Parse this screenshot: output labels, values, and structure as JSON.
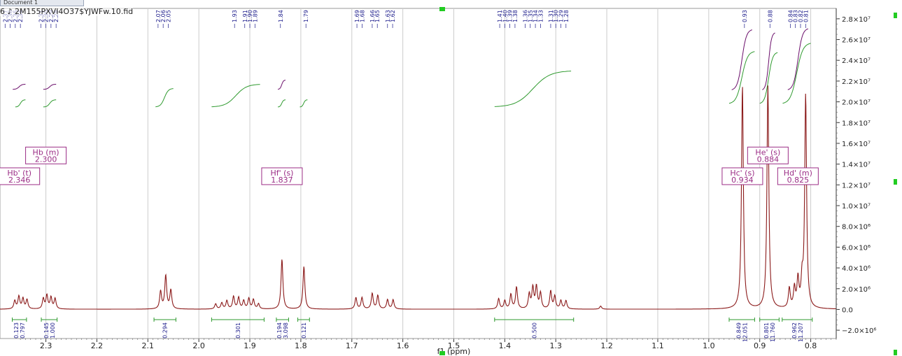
{
  "window": {
    "tab_label": "Document 1",
    "file_title": "6 ♪ 2M155PXVI4O37$YJWFw.10.fid"
  },
  "colors": {
    "spectrum": "#8b1a1a",
    "integral_purple": "#6b0f6b",
    "integral_green": "#2f9a2f",
    "peak_label": "#1a1a8a",
    "box_border": "#9b2d86",
    "range_bar": "#2e9a2e",
    "grid": "#cccccc",
    "green_marker": "#22cc22"
  },
  "chart_data": {
    "type": "line",
    "xlabel": "f1 (ppm)",
    "ylabel": "",
    "title": "",
    "x_reversed": true,
    "xlim": [
      2.39,
      0.75
    ],
    "ylim": [
      -2800000,
      29000000
    ],
    "x_ticks": [
      2.3,
      2.2,
      2.1,
      2.0,
      1.9,
      1.8,
      1.7,
      1.6,
      1.5,
      1.4,
      1.3,
      1.2,
      1.1,
      1.0,
      0.9,
      0.8
    ],
    "x_tick_labels": [
      "2.3",
      "2.2",
      "2.1",
      "2.0",
      "1.9",
      "1.8",
      "1.7",
      "1.6",
      "1.5",
      "1.4",
      "1.3",
      "1.2",
      "1.1",
      "1.0",
      "0.9",
      "0.8"
    ],
    "y_ticks": [
      -2000000,
      0,
      2000000,
      4000000,
      6000000,
      8000000,
      10000000,
      12000000,
      14000000,
      16000000,
      18000000,
      20000000,
      22000000,
      24000000,
      26000000,
      28000000
    ],
    "y_tick_labels": [
      "−2.0×10⁶",
      "0.0",
      "2.0×10⁶",
      "4.0×10⁶",
      "6.0×10⁶",
      "8.0×10⁶",
      "1.0×10⁷",
      "1.2×10⁷",
      "1.4×10⁷",
      "1.6×10⁷",
      "1.8×10⁷",
      "2.0×10⁷",
      "2.2×10⁷",
      "2.4×10⁷",
      "2.6×10⁷",
      "2.8×10⁷"
    ],
    "grid": true,
    "peaks": [
      {
        "x": 2.361,
        "h": 800000
      },
      {
        "x": 2.353,
        "h": 1200000
      },
      {
        "x": 2.345,
        "h": 1000000
      },
      {
        "x": 2.337,
        "h": 900000
      },
      {
        "x": 2.305,
        "h": 1000000
      },
      {
        "x": 2.298,
        "h": 1300000
      },
      {
        "x": 2.29,
        "h": 1100000
      },
      {
        "x": 2.282,
        "h": 1000000
      },
      {
        "x": 2.075,
        "h": 1700000
      },
      {
        "x": 2.065,
        "h": 3200000
      },
      {
        "x": 2.055,
        "h": 1800000
      },
      {
        "x": 1.967,
        "h": 500000
      },
      {
        "x": 1.955,
        "h": 600000
      },
      {
        "x": 1.945,
        "h": 800000
      },
      {
        "x": 1.932,
        "h": 1200000
      },
      {
        "x": 1.922,
        "h": 1100000
      },
      {
        "x": 1.912,
        "h": 800000
      },
      {
        "x": 1.902,
        "h": 1000000
      },
      {
        "x": 1.893,
        "h": 900000
      },
      {
        "x": 1.883,
        "h": 500000
      },
      {
        "x": 1.837,
        "h": 4800000
      },
      {
        "x": 1.794,
        "h": 4100000
      },
      {
        "x": 1.692,
        "h": 1100000
      },
      {
        "x": 1.68,
        "h": 1100000
      },
      {
        "x": 1.66,
        "h": 1500000
      },
      {
        "x": 1.649,
        "h": 1300000
      },
      {
        "x": 1.63,
        "h": 900000
      },
      {
        "x": 1.619,
        "h": 900000
      },
      {
        "x": 1.412,
        "h": 1000000
      },
      {
        "x": 1.4,
        "h": 800000
      },
      {
        "x": 1.388,
        "h": 1400000
      },
      {
        "x": 1.377,
        "h": 2100000
      },
      {
        "x": 1.352,
        "h": 1400000
      },
      {
        "x": 1.345,
        "h": 2000000
      },
      {
        "x": 1.338,
        "h": 2100000
      },
      {
        "x": 1.33,
        "h": 1500000
      },
      {
        "x": 1.31,
        "h": 1700000
      },
      {
        "x": 1.302,
        "h": 1200000
      },
      {
        "x": 1.29,
        "h": 800000
      },
      {
        "x": 1.28,
        "h": 800000
      },
      {
        "x": 1.212,
        "h": 300000
      },
      {
        "x": 0.934,
        "h": 21500000
      },
      {
        "x": 0.884,
        "h": 21500000
      },
      {
        "x": 0.842,
        "h": 1900000
      },
      {
        "x": 0.832,
        "h": 1900000
      },
      {
        "x": 0.825,
        "h": 2700000
      },
      {
        "x": 0.817,
        "h": 2400000
      },
      {
        "x": 0.81,
        "h": 20500000
      }
    ],
    "peak_width_ppm": 0.0022,
    "annotations": [
      {
        "name": "Hb (m)",
        "value": "2.300",
        "x": 2.3,
        "y": 14900000
      },
      {
        "name": "Hb' (t)",
        "value": "2.346",
        "x": 2.352,
        "y": 12900000
      },
      {
        "name": "Hf' (s)",
        "value": "1.837",
        "x": 1.837,
        "y": 12900000
      },
      {
        "name": "He' (s)",
        "value": "0.884",
        "x": 0.884,
        "y": 14900000
      },
      {
        "name": "Hc' (s)",
        "value": "0.934",
        "x": 0.934,
        "y": 12900000
      },
      {
        "name": "Hd' (m)",
        "value": "0.825",
        "x": 0.825,
        "y": 12900000
      }
    ],
    "peak_picks": [
      {
        "group": [
          2.38,
          2.37,
          2.36,
          2.35
        ],
        "labels": [
          "2.37",
          "2.36",
          "2.35",
          "2.34"
        ]
      },
      {
        "group": [
          2.31,
          2.3,
          2.29,
          2.28
        ],
        "labels": [
          "2.31",
          "2.30",
          "2.29",
          "2.28"
        ]
      },
      {
        "group": [
          2.08,
          2.07,
          2.06
        ],
        "labels": [
          "2.07",
          "2.06",
          "2.05"
        ]
      },
      {
        "group": [
          1.93,
          1.91,
          1.9,
          1.89
        ],
        "labels": [
          "1.93",
          "1.91",
          "1.90",
          "1.89"
        ]
      },
      {
        "group": [
          1.84
        ],
        "labels": [
          "1.84"
        ]
      },
      {
        "group": [
          1.79
        ],
        "labels": [
          "1.79"
        ]
      },
      {
        "group": [
          1.69,
          1.68,
          1.66,
          1.65,
          1.63,
          1.62
        ],
        "labels": [
          "1.69",
          "1.68",
          "1.66",
          "1.65",
          "1.63",
          "1.62"
        ]
      },
      {
        "group": [
          1.41,
          1.4,
          1.39,
          1.38,
          1.36,
          1.35,
          1.34,
          1.33,
          1.31,
          1.3,
          1.29,
          1.28
        ],
        "labels": [
          "1.41",
          "1.40",
          "1.39",
          "1.38",
          "1.36",
          "1.35",
          "1.34",
          "1.33",
          "1.31",
          "1.30",
          "1.29",
          "1.28"
        ]
      },
      {
        "group": [
          0.93
        ],
        "labels": [
          "0.93"
        ]
      },
      {
        "group": [
          0.88
        ],
        "labels": [
          "0.88"
        ]
      },
      {
        "group": [
          0.84,
          0.83,
          0.82,
          0.81
        ],
        "labels": [
          "0.84",
          "0.83",
          "0.82",
          "0.81"
        ]
      }
    ],
    "integrals_green": [
      {
        "from": 2.36,
        "to": 2.34,
        "base": 19500000,
        "rise": 700000
      },
      {
        "from": 2.305,
        "to": 2.28,
        "base": 19500000,
        "rise": 700000
      },
      {
        "from": 2.085,
        "to": 2.05,
        "base": 19500000,
        "rise": 1800000
      },
      {
        "from": 1.975,
        "to": 1.88,
        "base": 19500000,
        "rise": 2200000
      },
      {
        "from": 1.845,
        "to": 1.83,
        "base": 19500000,
        "rise": 700000
      },
      {
        "from": 1.802,
        "to": 1.787,
        "base": 19500000,
        "rise": 700000
      },
      {
        "from": 1.42,
        "to": 1.27,
        "base": 19500000,
        "rise": 3500000
      },
      {
        "from": 0.96,
        "to": 0.91,
        "base": 19800000,
        "rise": 5100000
      },
      {
        "from": 0.9,
        "to": 0.865,
        "base": 19800000,
        "rise": 5000000
      },
      {
        "from": 0.855,
        "to": 0.8,
        "base": 19800000,
        "rise": 5900000
      }
    ],
    "integrals_purple": [
      {
        "from": 2.365,
        "to": 2.34,
        "base": 21200000,
        "rise": 500000
      },
      {
        "from": 2.305,
        "to": 2.28,
        "base": 21200000,
        "rise": 500000
      },
      {
        "from": 1.845,
        "to": 1.83,
        "base": 21200000,
        "rise": 900000
      },
      {
        "from": 0.955,
        "to": 0.915,
        "base": 21100000,
        "rise": 5900000
      },
      {
        "from": 0.895,
        "to": 0.87,
        "base": 21100000,
        "rise": 5600000
      },
      {
        "from": 0.845,
        "to": 0.805,
        "base": 21100000,
        "rise": 6000000
      }
    ],
    "integral_values": [
      {
        "from": 2.366,
        "to": 2.338,
        "labels": [
          "0.123",
          "0.797"
        ]
      },
      {
        "from": 2.309,
        "to": 2.278,
        "labels": [
          "0.145",
          "1.000"
        ]
      },
      {
        "from": 2.088,
        "to": 2.045,
        "labels": [
          "0.294"
        ]
      },
      {
        "from": 1.975,
        "to": 1.872,
        "labels": [
          "0.301"
        ]
      },
      {
        "from": 1.848,
        "to": 1.824,
        "labels": [
          "0.194",
          "3.098"
        ]
      },
      {
        "from": 1.806,
        "to": 1.783,
        "labels": [
          "0.121"
        ]
      },
      {
        "from": 1.42,
        "to": 1.265,
        "labels": [
          "0.500"
        ]
      },
      {
        "from": 0.96,
        "to": 0.91,
        "labels": [
          "0.849",
          "12.051"
        ]
      },
      {
        "from": 0.9,
        "to": 0.862,
        "labels": [
          "0.801",
          "11.760"
        ]
      },
      {
        "from": 0.856,
        "to": 0.797,
        "labels": [
          "0.962",
          "11.207"
        ]
      }
    ]
  }
}
